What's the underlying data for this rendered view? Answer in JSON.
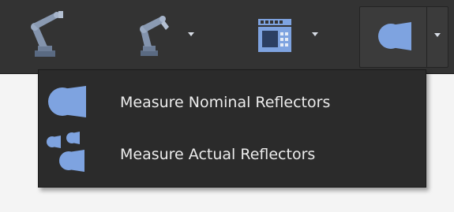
{
  "toolbar": {
    "buttons": [
      {
        "icon": "robot-arm-icon",
        "has_dropdown": false
      },
      {
        "icon": "robot-arm-icon",
        "has_dropdown": true
      },
      {
        "icon": "controller-panel-icon",
        "has_dropdown": true
      },
      {
        "icon": "measure-reflector-icon",
        "has_dropdown": true,
        "selected": true
      }
    ]
  },
  "dropdown": {
    "items": [
      {
        "icon": "measure-nominal-reflectors-icon",
        "label": "Measure Nominal Reflectors"
      },
      {
        "icon": "measure-actual-reflectors-icon",
        "label": "Measure Actual Reflectors"
      }
    ]
  },
  "colors": {
    "toolbar_bg": "#333333",
    "menu_bg": "#2b2b2b",
    "icon_blue": "#7ea3e0",
    "icon_slate": "#5a6a82",
    "text": "#ececec",
    "content_bg": "#f4f4f4"
  }
}
